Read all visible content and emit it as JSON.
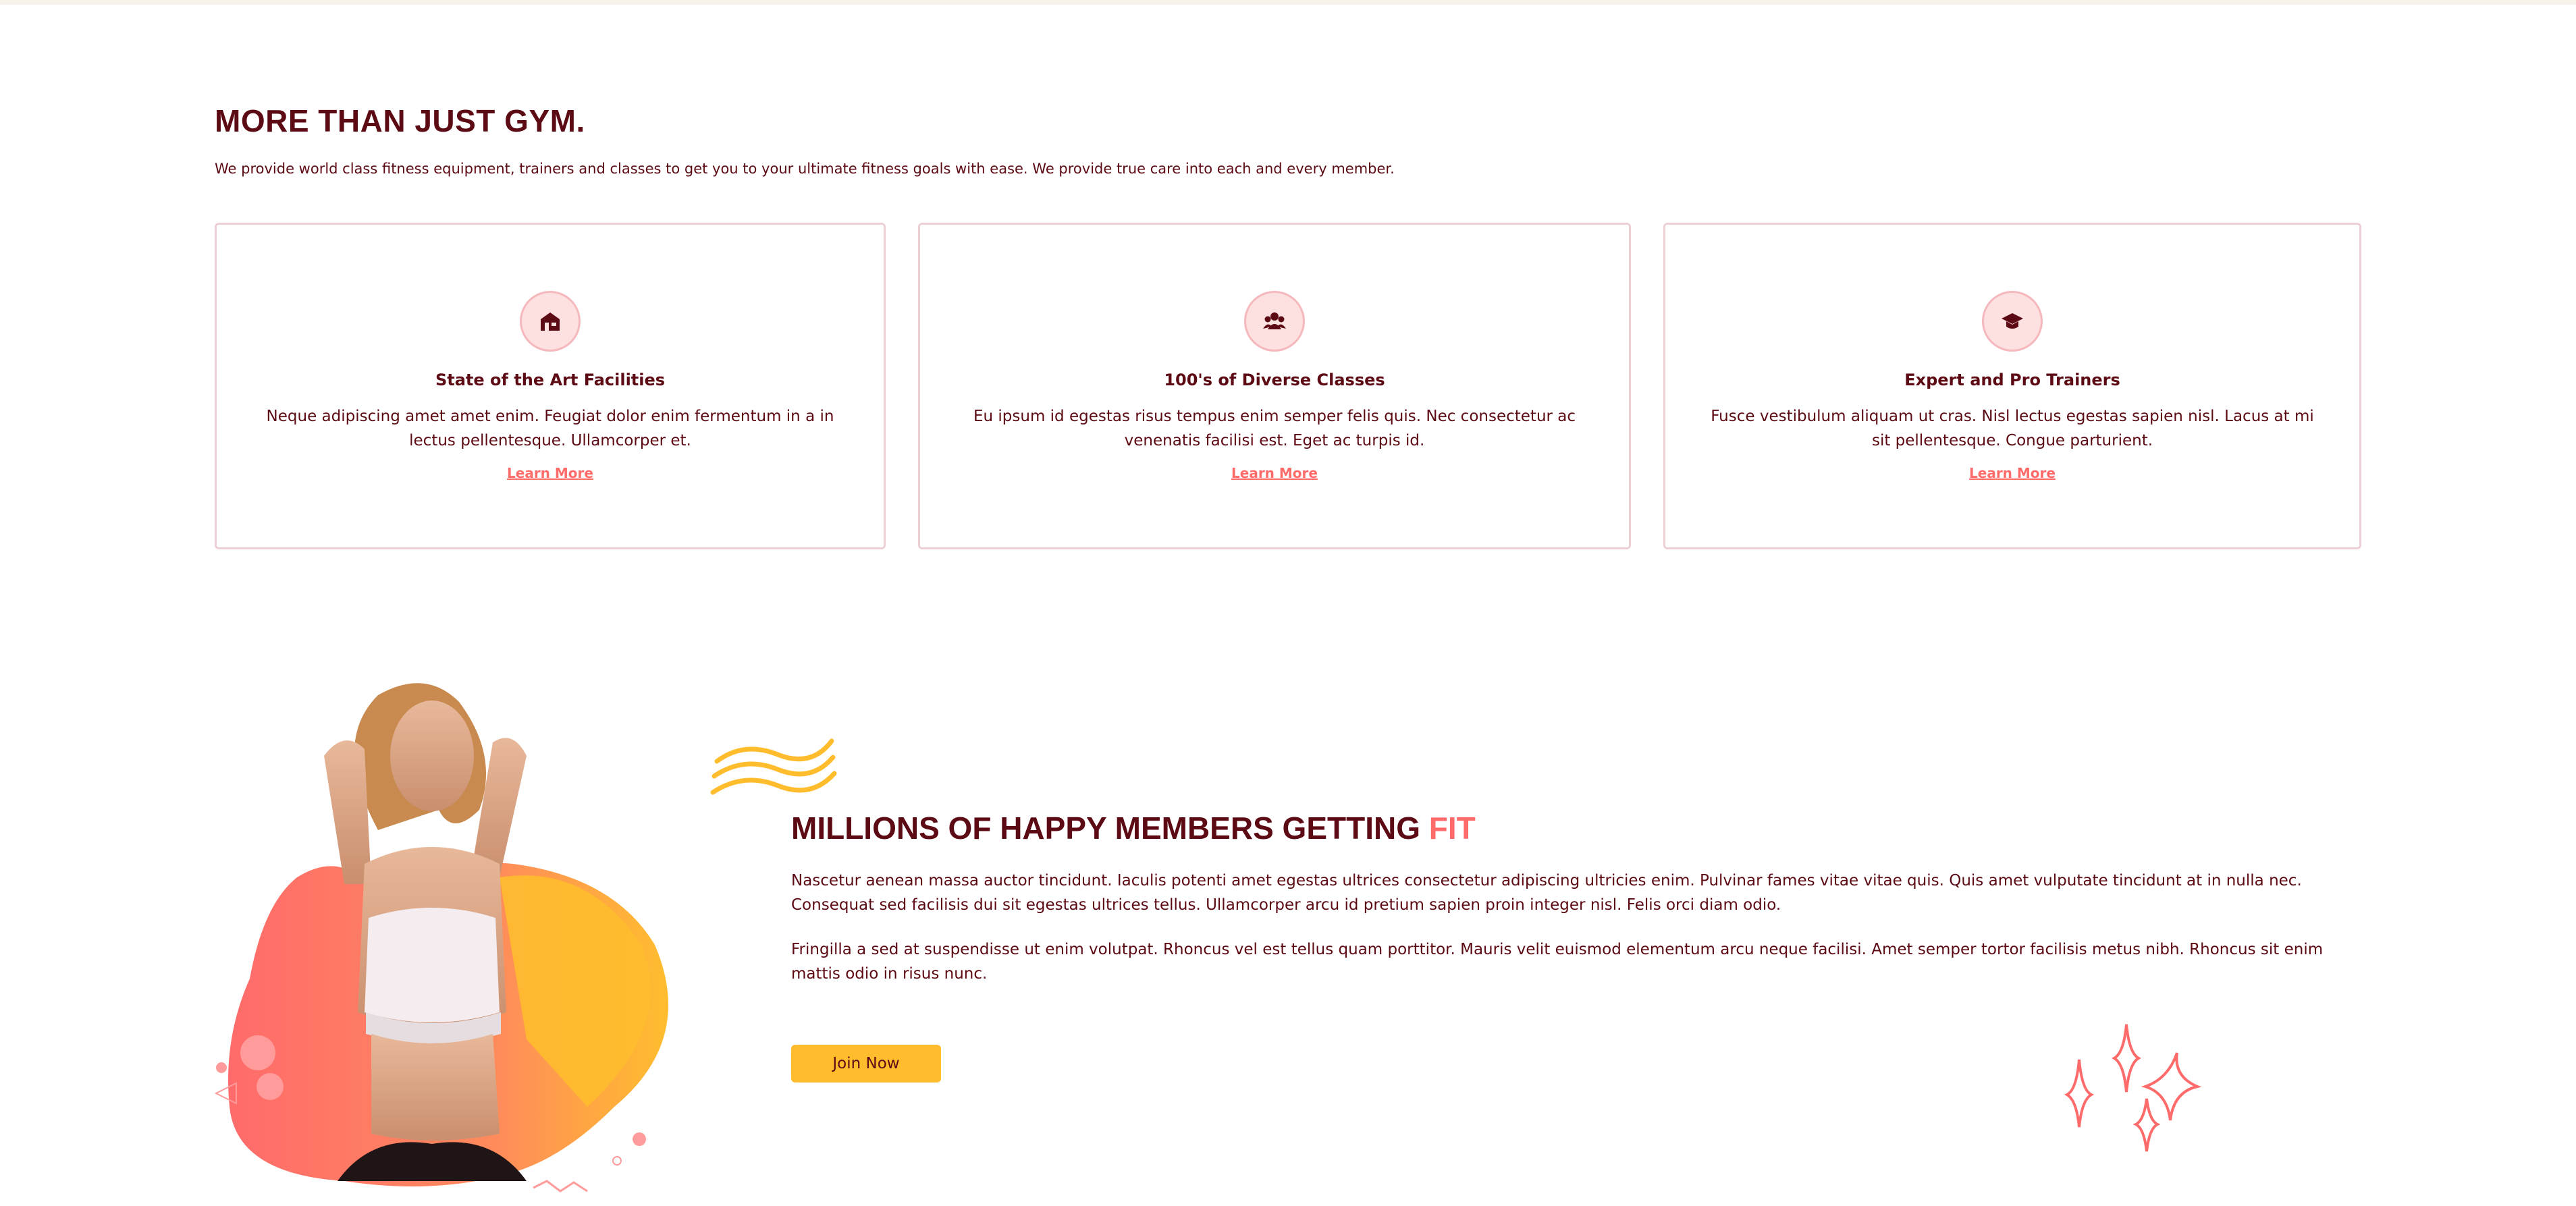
{
  "about": {
    "title": "MORE THAN JUST GYM.",
    "intro": "We provide world class fitness equipment, trainers and classes to get you to your ultimate fitness goals with ease. We provide true care into each and every member."
  },
  "cards": [
    {
      "icon": "gym-building-icon",
      "title": "State of the Art Facilities",
      "text": "Neque adipiscing amet amet enim. Feugiat dolor enim fermentum in a in lectus pellentesque. Ullamcorper et.",
      "link": "Learn More"
    },
    {
      "icon": "users-group-icon",
      "title": "100's of Diverse Classes",
      "text": "Eu ipsum id egestas risus tempus enim semper felis quis. Nec consectetur ac venenatis facilisi est. Eget ac turpis id.",
      "link": "Learn More"
    },
    {
      "icon": "graduation-cap-icon",
      "title": "Expert and Pro Trainers",
      "text": "Fusce vestibulum aliquam ut cras. Nisl lectus egestas sapien nisl. Lacus at mi sit pellentesque. Congue parturient.",
      "link": "Learn More"
    }
  ],
  "members": {
    "title_main": "MILLIONS OF HAPPY MEMBERS GETTING",
    "title_accent": "FIT",
    "paragraph1": "Nascetur aenean massa auctor tincidunt. Iaculis potenti amet egestas ultrices consectetur adipiscing ultricies enim. Pulvinar fames vitae vitae quis. Quis amet vulputate tincidunt at in nulla nec. Consequat sed facilisis dui sit egestas ultrices tellus. Ullamcorper arcu id pretium sapien proin integer nisl. Felis orci diam odio.",
    "paragraph2": "Fringilla a sed at suspendisse ut enim volutpat. Rhoncus vel est tellus quam porttitor. Mauris velit euismod elementum arcu neque facilisi. Amet semper tortor facilisis metus nibh. Rhoncus sit enim mattis odio in risus nunc.",
    "button": "Join Now"
  },
  "colors": {
    "primary_text": "#5c0a13",
    "accent_coral": "#ff6b6b",
    "accent_yellow": "#ffbd2e",
    "card_border": "#edcfd6",
    "icon_bg": "#fde0e0"
  }
}
